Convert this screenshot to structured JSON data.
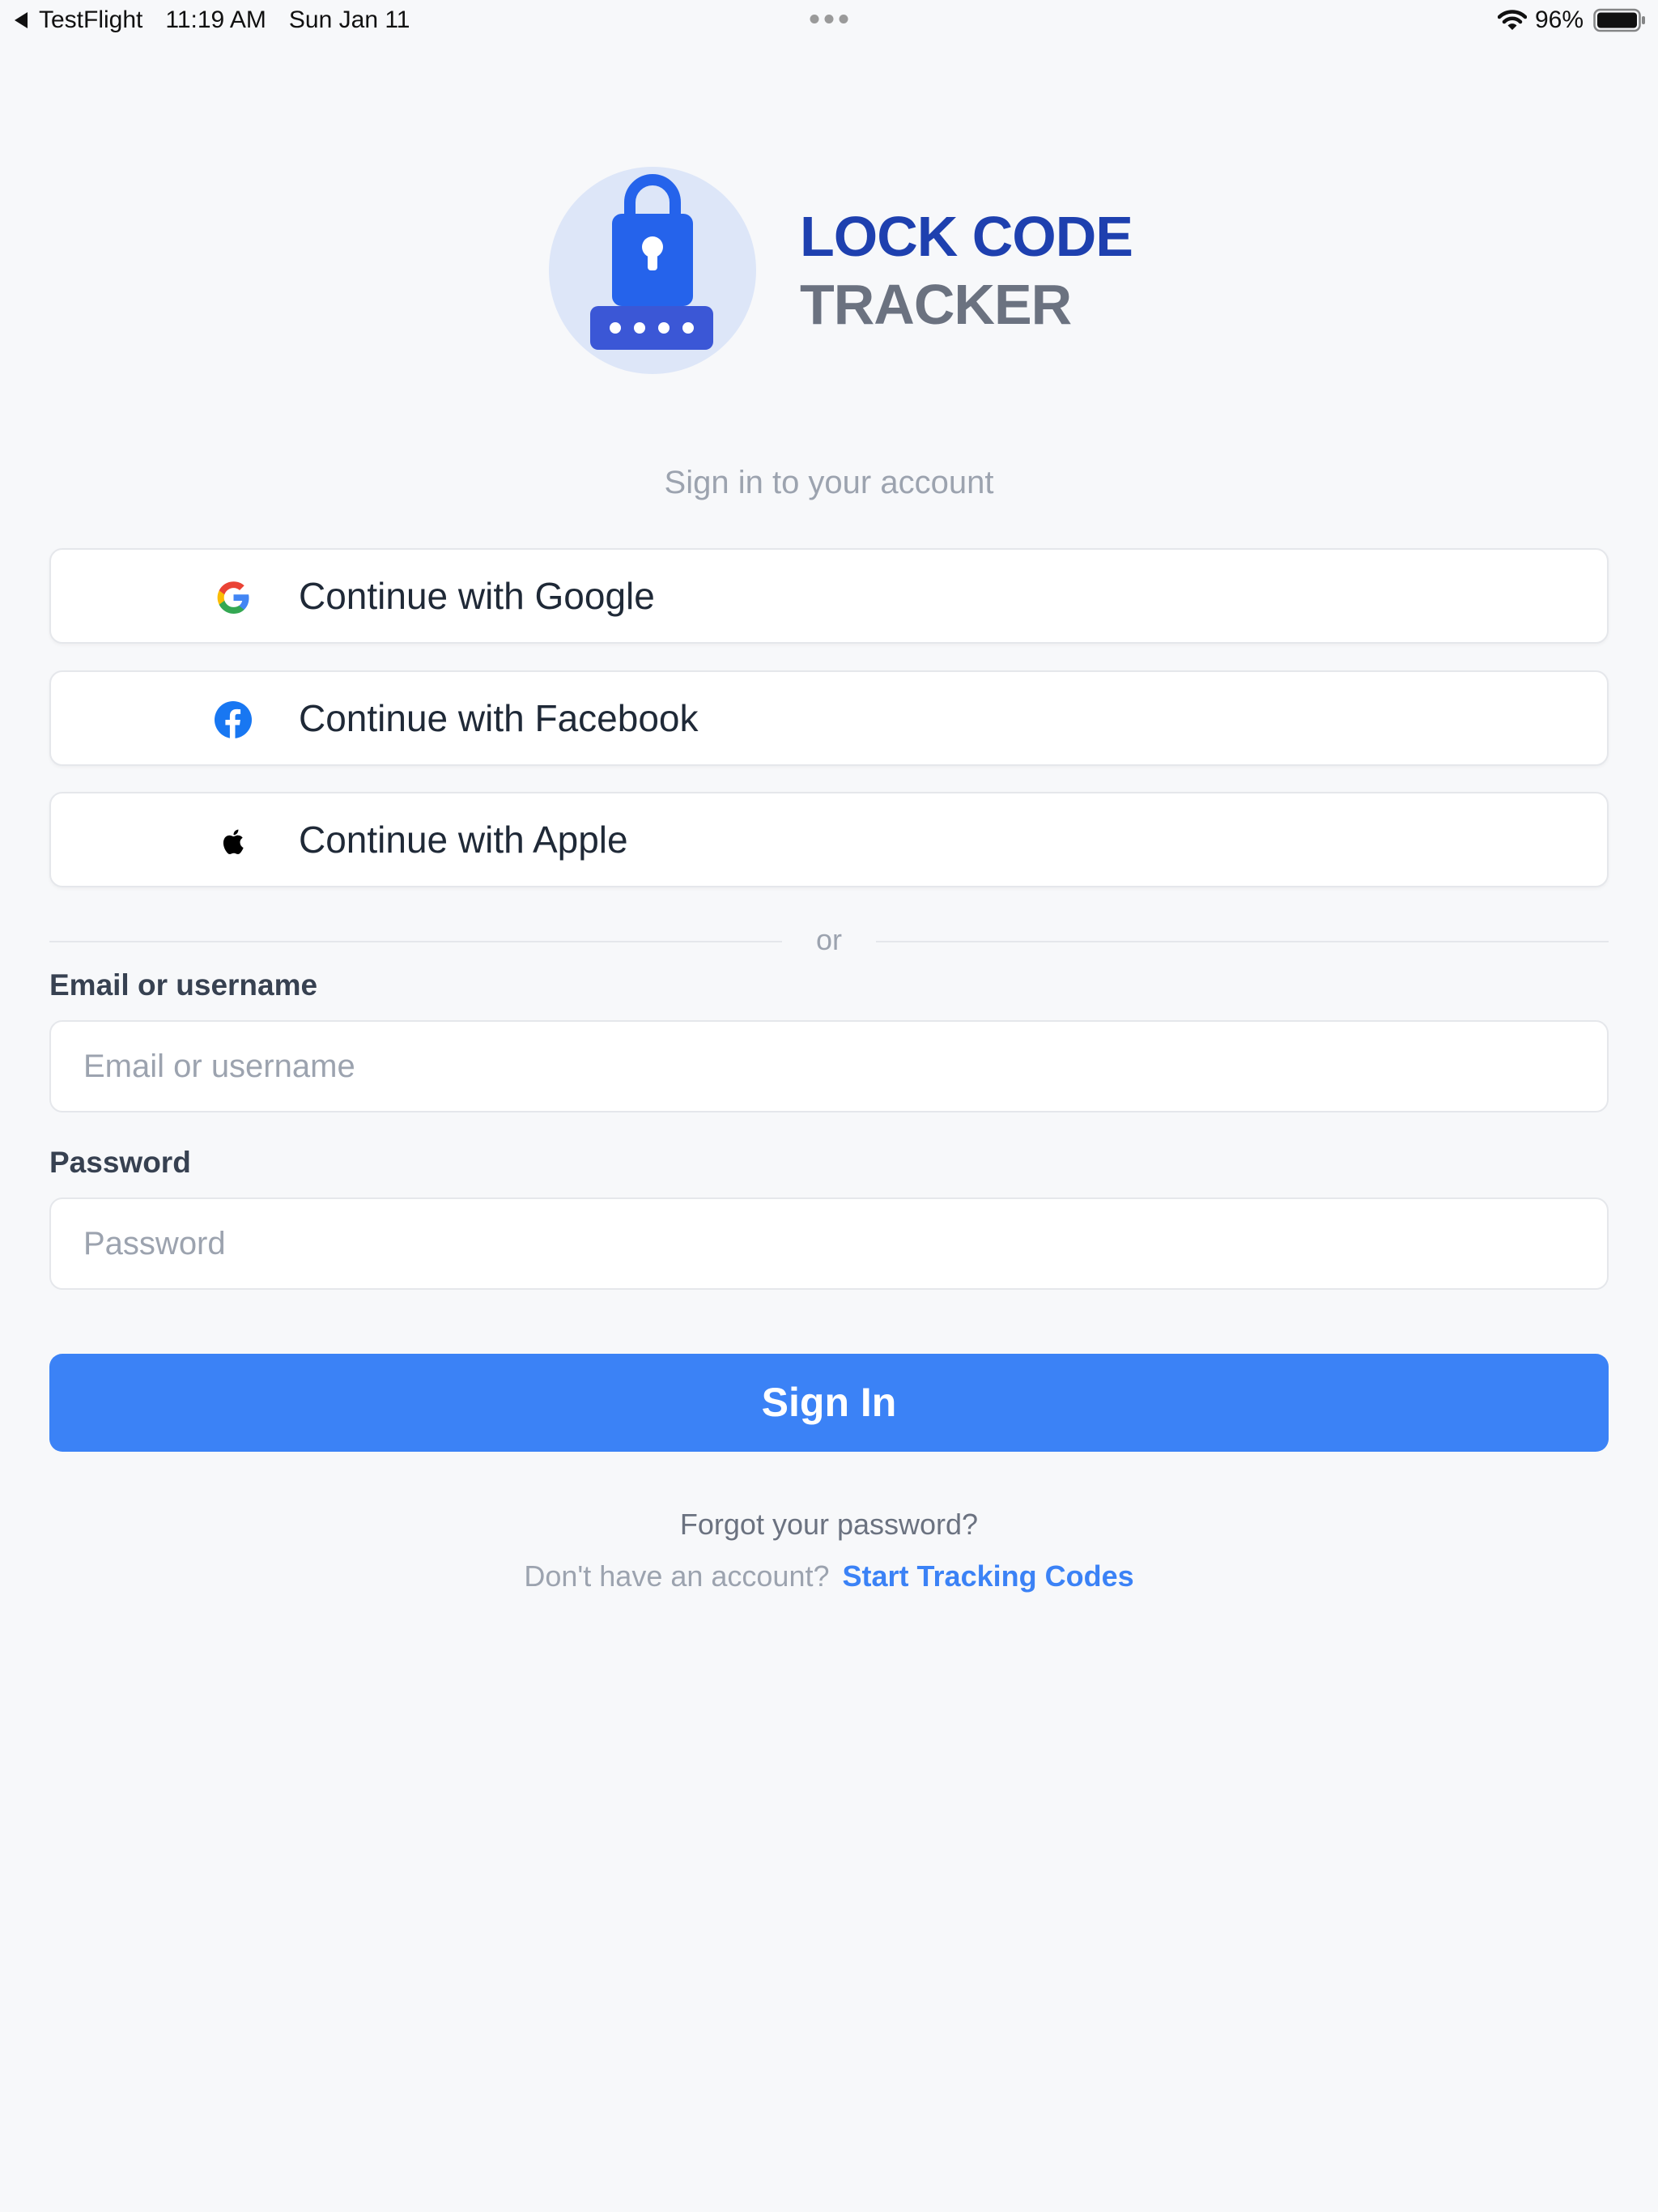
{
  "status_bar": {
    "app_name": "TestFlight",
    "time": "11:19 AM",
    "date": "Sun Jan 11",
    "battery_percent": "96%",
    "icons": [
      "back-arrow-icon",
      "more-dots-icon",
      "wifi-icon",
      "battery-icon"
    ]
  },
  "brand": {
    "line1": "LOCK CODE",
    "line2": "TRACKER",
    "logo_icon": "padlock-with-code-icon",
    "colors": {
      "primary": "#1e40af",
      "secondary": "#6b7280",
      "logo_bg": "#dde6f8",
      "logo_accent": "#2563eb"
    }
  },
  "subtitle": "Sign in to your account",
  "social": {
    "google_label": "Continue with Google",
    "facebook_label": "Continue with Facebook",
    "apple_label": "Continue with Apple"
  },
  "divider_text": "or",
  "form": {
    "email_label": "Email or username",
    "email_placeholder": "Email or username",
    "email_value": "",
    "password_label": "Password",
    "password_placeholder": "Password",
    "password_value": ""
  },
  "sign_in_label": "Sign In",
  "forgot_password": "Forgot your password?",
  "signup_prompt": "Don't have an account?",
  "signup_link": "Start Tracking Codes",
  "colors": {
    "accent": "#3b82f6",
    "background": "#f7f8fa"
  }
}
